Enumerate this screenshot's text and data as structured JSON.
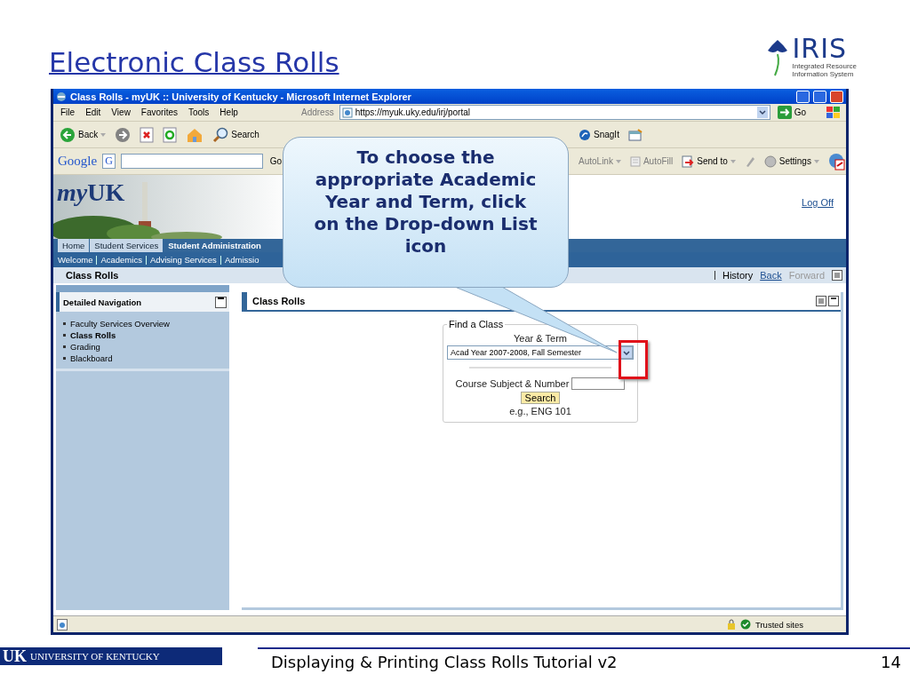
{
  "slide": {
    "title": "Electronic Class Rolls",
    "logo": {
      "name": "IRIS",
      "subtitle": [
        "Integrated Resource",
        "Information System"
      ]
    }
  },
  "browser": {
    "title": "Class Rolls - myUK :: University of Kentucky - Microsoft Internet Explorer",
    "menu": [
      "File",
      "Edit",
      "View",
      "Favorites",
      "Tools",
      "Help"
    ],
    "address": {
      "label": "Address",
      "value": "https://myuk.uky.edu/irj/portal",
      "go": "Go"
    },
    "toolbar": [
      {
        "kind": "back",
        "label": "Back",
        "disabled": false
      },
      {
        "kind": "forward",
        "disabled": true
      },
      {
        "kind": "stop",
        "disabled": false
      },
      {
        "kind": "refresh",
        "disabled": false
      },
      {
        "kind": "home",
        "disabled": false
      },
      {
        "kind": "search",
        "label": "Search",
        "disabled": false
      }
    ],
    "toolbar_right": [
      {
        "kind": "snagit",
        "label": "SnagIt",
        "disabled": false
      },
      {
        "kind": "capture",
        "disabled": false
      }
    ],
    "google_bar": {
      "logo": "Google",
      "menu": "G",
      "go": "Go",
      "items": [
        {
          "kind": "autolink",
          "label": "AutoLink",
          "disabled": true
        },
        {
          "kind": "autofill",
          "label": "AutoFill",
          "disabled": true
        },
        {
          "kind": "sendto",
          "label": "Send to",
          "disabled": false
        },
        {
          "kind": "pencil",
          "disabled": true
        },
        {
          "kind": "settings",
          "label": "Settings",
          "disabled": false
        },
        {
          "kind": "pdf",
          "disabled": false
        }
      ]
    },
    "status_bar": {
      "zone": "Trusted sites"
    }
  },
  "portal": {
    "logo": {
      "prefix": "my",
      "main": "UK"
    },
    "log_off": "Log Off",
    "tabs": [
      {
        "label": "Home",
        "selected": false
      },
      {
        "label": "Student Services",
        "selected": false
      },
      {
        "label": "Student Administration",
        "selected": true
      }
    ],
    "subnav": [
      "Welcome",
      "Academics",
      "Advising Services",
      "Admissio"
    ],
    "page_title": "Class Rolls",
    "history": "History",
    "back": "Back",
    "forward": {
      "label": "Forward",
      "disabled": true
    },
    "navigation": {
      "title": "Detailed Navigation",
      "items": [
        {
          "label": "Faculty Services Overview",
          "selected": false
        },
        {
          "label": "Class Rolls",
          "selected": true
        },
        {
          "label": "Grading",
          "selected": false
        },
        {
          "label": "Blackboard",
          "selected": false
        }
      ]
    },
    "content": {
      "title": "Class Rolls",
      "form": {
        "legend": "Find a Class",
        "year_label": "Year & Term",
        "year_value": "Acad Year 2007-2008, Fall Semester",
        "course_label": "Course Subject & Number",
        "search": "Search",
        "hint": "e.g., ENG 101"
      }
    }
  },
  "callout": "To choose the appropriate Academic Year and Term, click on the Drop-down List icon",
  "footer": {
    "logo_mark": "UK",
    "logo_text": "UNIVERSITY OF KENTUCKY",
    "title": "Displaying & Printing Class Rolls Tutorial v2",
    "page": "14"
  }
}
